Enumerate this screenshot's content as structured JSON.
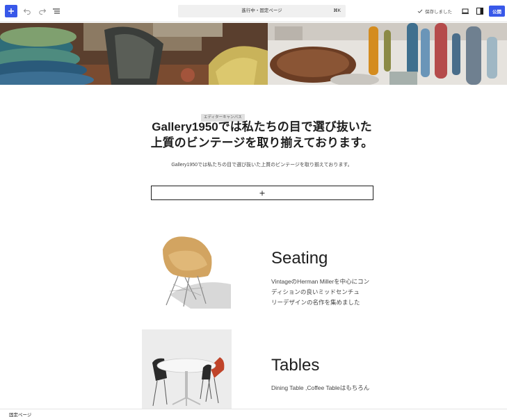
{
  "toolbar": {
    "add_block_icon": "plus-icon",
    "undo_icon": "undo-icon",
    "redo_icon": "redo-icon",
    "list_view_icon": "list-view-icon",
    "command_title": "進行中・固定ページ",
    "command_shortcut": "⌘K",
    "saved_label": "保存しました",
    "saved_icon": "check-icon",
    "view_icon": "desktop-icon",
    "settings_icon": "sidebar-toggle-icon",
    "publish_label": "公開",
    "accent_color": "#3858e9"
  },
  "canvas": {
    "badge_label": "エディターキャンバス",
    "heading_line1": "Gallery1950では私たちの目で選び抜いた",
    "heading_line2": "上質のビンテージを取り揃えております。",
    "subtext": "Gallery1950では私たちの目で選び抜いた上質のビンテージを取り揃えております。",
    "appender_icon": "plus-icon"
  },
  "sections": [
    {
      "title": "Seating",
      "desc_lines": [
        "VintageのHerman Millerを中心にコン",
        "ディションの良いミッドセンチュ",
        "リーデザインの名作を集めました"
      ],
      "image": "chair-image"
    },
    {
      "title": "Tables",
      "desc_lines": [
        "Dining Table ,Coffee Tableはもちろん"
      ],
      "image": "table-image"
    }
  ],
  "footer": {
    "breadcrumb": "固定ページ"
  }
}
